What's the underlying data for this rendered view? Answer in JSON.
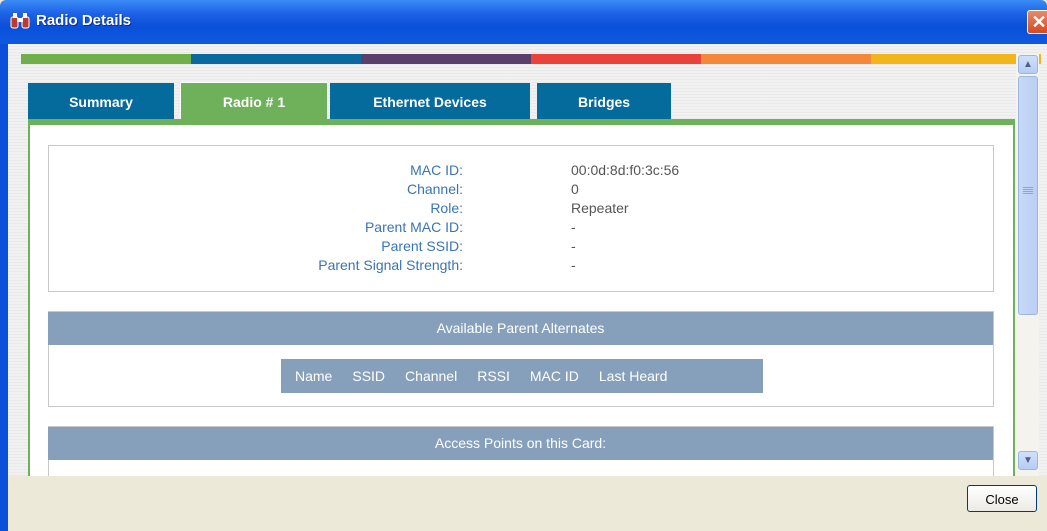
{
  "window": {
    "title": "Radio Details",
    "close_glyph": "✕"
  },
  "color_strip": [
    "#6fb04a",
    "#0a6aa0",
    "#5a3e6c",
    "#e8423a",
    "#f4883a",
    "#f2b51c"
  ],
  "tabs": [
    {
      "label": "Summary",
      "active": false
    },
    {
      "label": "Radio # 1",
      "active": true
    },
    {
      "label": "Ethernet Devices",
      "active": false
    },
    {
      "label": "Bridges",
      "active": false
    }
  ],
  "radio_info": [
    {
      "label": "MAC ID:",
      "value": "00:0d:8d:f0:3c:56"
    },
    {
      "label": "Channel:",
      "value": "0"
    },
    {
      "label": "Role:",
      "value": "Repeater"
    },
    {
      "label": "Parent MAC ID:",
      "value": "-"
    },
    {
      "label": "Parent SSID:",
      "value": "-"
    },
    {
      "label": "Parent Signal Strength:",
      "value": "-"
    }
  ],
  "sections": {
    "parent_alternates": "Available Parent Alternates",
    "access_points": "Access Points on this Card:"
  },
  "alternates_columns": [
    "Name",
    "SSID",
    "Channel",
    "RSSI",
    "MAC ID",
    "Last Heard"
  ],
  "scrollbar": {
    "up_glyph": "▲",
    "down_glyph": "▼"
  },
  "footer": {
    "close_label": "Close"
  }
}
